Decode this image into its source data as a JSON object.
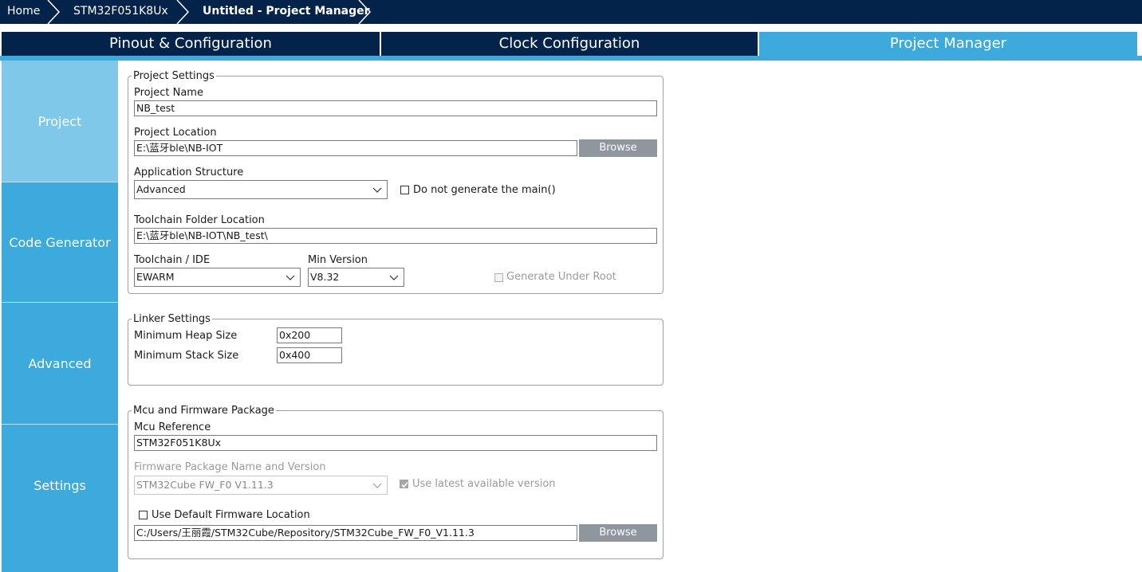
{
  "breadcrumb": {
    "items": [
      "Home",
      "STM32F051K8Ux",
      "Untitled - Project Manager"
    ]
  },
  "tabs": [
    "Pinout & Configuration",
    "Clock Configuration",
    "Project Manager"
  ],
  "selected_tab": "Project Manager",
  "sidebar": {
    "items": [
      "Project",
      "Code Generator",
      "Advanced Settings"
    ],
    "selected": "Project"
  },
  "project_settings": {
    "title": "Project Settings",
    "project_name_label": "Project Name",
    "project_name": "NB_test",
    "project_location_label": "Project Location",
    "project_location": "E:\\蓝牙ble\\NB-IOT",
    "browse_label": "Browse",
    "app_structure_label": "Application Structure",
    "app_structure": "Advanced",
    "no_main_label": "Do not generate the main()",
    "toolchain_folder_label": "Toolchain Folder Location",
    "toolchain_folder": "E:\\蓝牙ble\\NB-IOT\\NB_test\\",
    "toolchain_ide_label": "Toolchain / IDE",
    "toolchain_ide": "EWARM",
    "min_version_label": "Min Version",
    "min_version": "V8.32",
    "generate_under_root_label": "Generate Under Root"
  },
  "linker_settings": {
    "title": "Linker Settings",
    "heap_label": "Minimum Heap Size",
    "heap_value": "0x200",
    "stack_label": "Minimum Stack Size",
    "stack_value": "0x400"
  },
  "mcu_firmware": {
    "title": "Mcu and Firmware Package",
    "mcu_ref_label": "Mcu Reference",
    "mcu_ref": "STM32F051K8Ux",
    "fw_name_label": "Firmware Package Name and Version",
    "fw_name": "STM32Cube FW_F0 V1.11.3",
    "use_latest_label": "Use latest available version",
    "use_default_label": "Use Default Firmware Location",
    "fw_location": "C:/Users/王丽霞/STM32Cube/Repository/STM32Cube_FW_F0_V1.11.3",
    "browse_label": "Browse"
  },
  "colors": {
    "nav_dark": "#03234b",
    "accent": "#3caadc",
    "sidebar_selected": "#7fc8ea",
    "button_gray": "#8f969d"
  }
}
